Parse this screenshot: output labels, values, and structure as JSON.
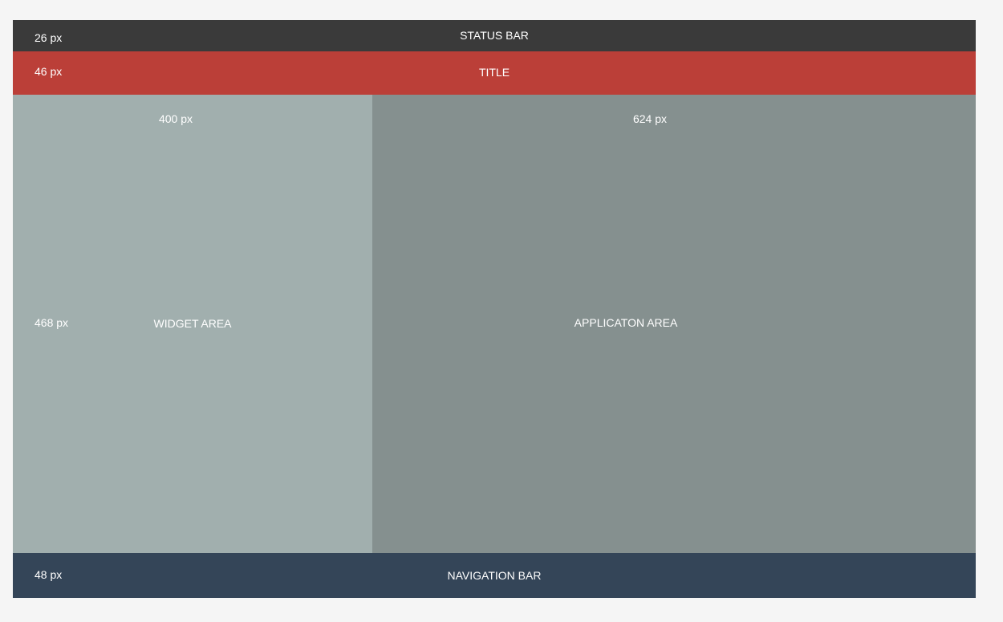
{
  "colors": {
    "page_background": "#f5f5f5",
    "status_bar": "#3a3a3a",
    "title_bar": "#bb3f38",
    "widget_area": "#a1afae",
    "application_area": "#85908f",
    "navigation_bar": "#344558",
    "text": "#ffffff"
  },
  "status_bar": {
    "label": "STATUS BAR",
    "height_label": "26 px"
  },
  "title_bar": {
    "label": "TITLE",
    "height_label": "46 px"
  },
  "widget_area": {
    "label": "WIDGET AREA",
    "width_label": "400 px",
    "height_label": "468 px"
  },
  "application_area": {
    "label": "APPLICATON AREA",
    "width_label": "624 px"
  },
  "navigation_bar": {
    "label": "NAVIGATION BAR",
    "height_label": "48 px"
  }
}
